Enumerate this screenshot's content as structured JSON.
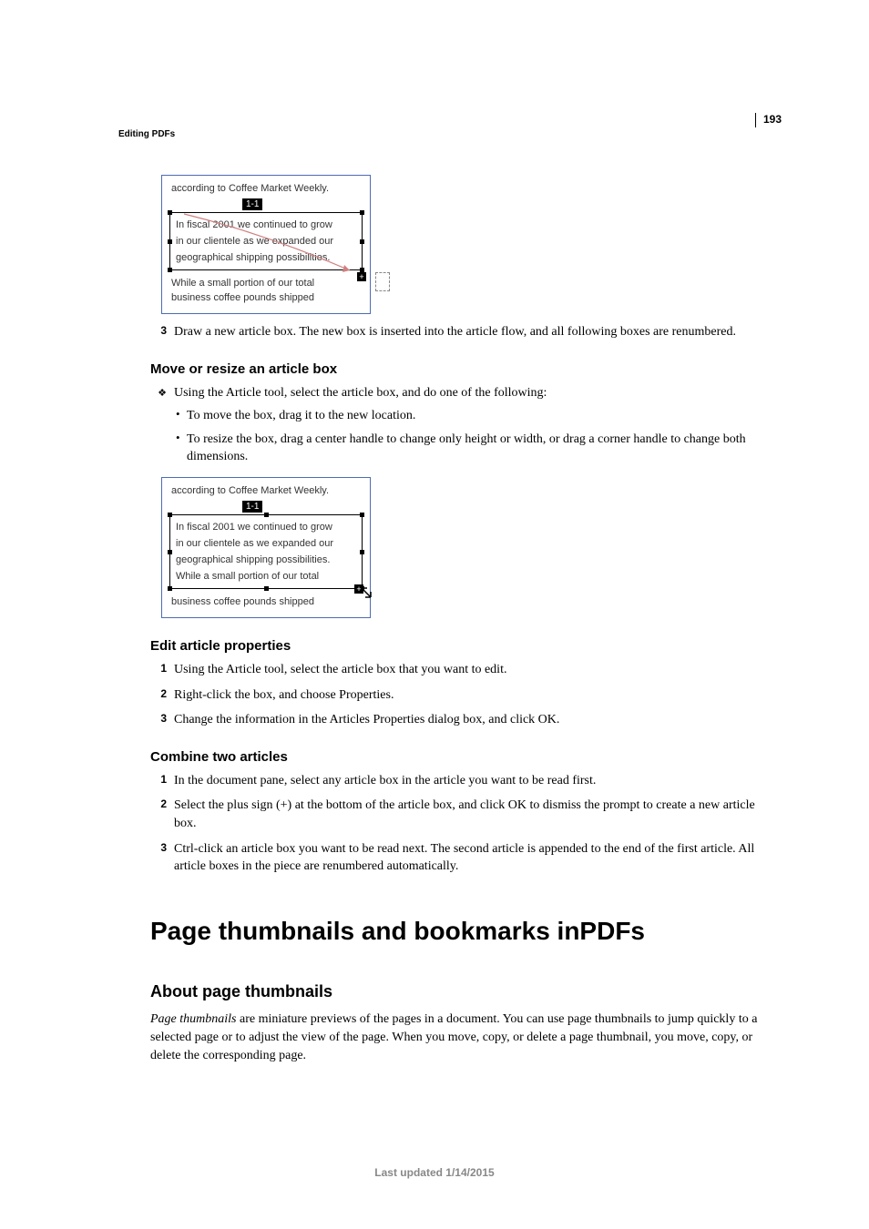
{
  "page_number": "193",
  "breadcrumb": "Editing PDFs",
  "figure1": {
    "top_text": "according to Coffee Market Weekly.",
    "tag": "1-1",
    "line1": "In fiscal 2001 we continued to grow",
    "line2": "in our clientele as we expanded our",
    "line3": "geographical shipping possibilities.",
    "bottom_line1": "While a small portion of our total",
    "bottom_line2": "business coffee pounds shipped"
  },
  "step3_num": "3",
  "step3_text": "Draw a new article box. The new box is inserted into the article flow, and all following boxes are renumbered.",
  "section_move_resize": {
    "heading": "Move or resize an article box",
    "bullet": "Using the Article tool, select the article box, and do one of the following:",
    "sub1": "To move the box, drag it to the new location.",
    "sub2": "To resize the box, drag a center handle to change only height or width, or drag a corner handle to change both dimensions."
  },
  "figure2": {
    "top_text": "according to Coffee Market Weekly.",
    "tag": "1-1",
    "line1": "In fiscal 2001 we continued to grow",
    "line2": "in our clientele as we expanded our",
    "line3": "geographical shipping possibilities.",
    "line4": "While a small portion of our total",
    "bottom_line1": "business coffee pounds shipped"
  },
  "section_edit_props": {
    "heading": "Edit article properties",
    "step1": "Using the Article tool, select the article box that you want to edit.",
    "step2": "Right-click the box, and choose Properties.",
    "step3": "Change the information in the Articles Properties dialog box, and click OK."
  },
  "section_combine": {
    "heading": "Combine two articles",
    "step1": "In the document pane, select any article box in the article you want to be read first.",
    "step2": "Select the plus sign (+) at the bottom of the article box, and click OK to dismiss the prompt to create a new article box.",
    "step3": "Ctrl-click an article box you want to be read next. The second article is appended to the end of the first article. All article boxes in the piece are renumbered automatically."
  },
  "h1": "Page thumbnails and bookmarks inPDFs",
  "about_thumbnails": {
    "heading": "About page thumbnails",
    "para_italic": "Page thumbnails",
    "para_rest": " are miniature previews of the pages in a document. You can use page thumbnails to jump quickly to a selected page or to adjust the view of the page. When you move, copy, or delete a page thumbnail, you move, copy, or delete the corresponding page."
  },
  "footer": "Last updated 1/14/2015",
  "nums": {
    "n1": "1",
    "n2": "2",
    "n3": "3"
  }
}
